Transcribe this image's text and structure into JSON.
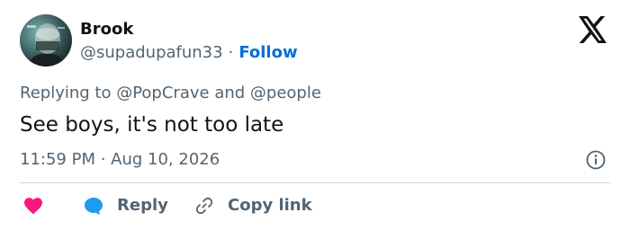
{
  "author": {
    "name": "Brook",
    "handle": "@supadupafun33",
    "separator": "·",
    "follow_label": "Follow",
    "avatar_icon": "avatar-photo"
  },
  "reply_context": {
    "prefix": "Replying to ",
    "mention1": "@PopCrave",
    "joiner": " and ",
    "mention2": "@people"
  },
  "tweet": {
    "text": "See boys, it's not too late",
    "timestamp": "11:59 PM · Aug 10, 2026"
  },
  "actions": {
    "reply_label": "Reply",
    "copy_link_label": "Copy link"
  },
  "icons": {
    "logo": "x-logo-icon",
    "info": "info-icon",
    "like": "heart-icon",
    "reply": "reply-bubble-icon",
    "copy": "link-icon"
  },
  "colors": {
    "text": "#0f1419",
    "secondary": "#536471",
    "link": "#006fd6",
    "heart": "#f91880",
    "reply": "#1d9bf0",
    "divider": "#cfd9de"
  }
}
